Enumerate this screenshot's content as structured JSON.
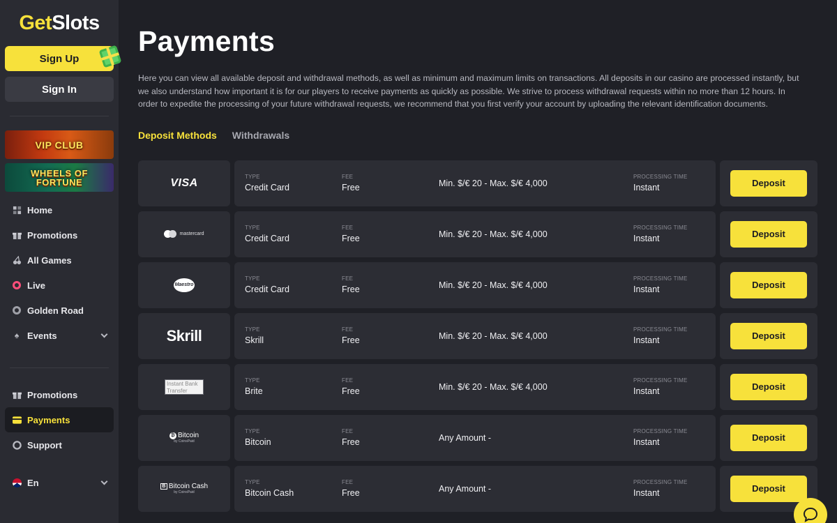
{
  "brand": {
    "get": "Get",
    "slots": "Slots"
  },
  "auth": {
    "signup": "Sign Up",
    "signin": "Sign In"
  },
  "banners": {
    "vip": "VIP CLUB",
    "wheel_line1": "WHEELS OF",
    "wheel_line2": "FORTUNE"
  },
  "nav": {
    "home": "Home",
    "promotions": "Promotions",
    "all_games": "All Games",
    "live": "Live",
    "golden_road": "Golden Road",
    "events": "Events"
  },
  "nav2": {
    "promotions": "Promotions",
    "payments": "Payments",
    "support": "Support"
  },
  "language": "En",
  "page": {
    "title": "Payments",
    "intro": "Here you can view all available deposit and withdrawal methods, as well as minimum and maximum limits on transactions. All deposits in our casino are processed instantly, but we also understand how important it is for our players to receive payments as quickly as possible. We strive to process withdrawal requests within no more than 12 hours. In order to expedite the processing of your future withdrawal requests, we recommend that you first verify your account by uploading the relevant identification documents."
  },
  "tabs": {
    "deposit": "Deposit Methods",
    "withdrawals": "Withdrawals"
  },
  "labels": {
    "type": "TYPE",
    "fee": "FEE",
    "processing": "PROCESSING TIME",
    "deposit_btn": "Deposit"
  },
  "methods": [
    {
      "logo": "VISA",
      "type": "Credit Card",
      "fee": "Free",
      "limits": "Min. $/€ 20 - Max. $/€ 4,000",
      "processing": "Instant"
    },
    {
      "logo": "mastercard",
      "type": "Credit Card",
      "fee": "Free",
      "limits": "Min. $/€ 20 - Max. $/€ 4,000",
      "processing": "Instant"
    },
    {
      "logo": "Maestro",
      "type": "Credit Card",
      "fee": "Free",
      "limits": "Min. $/€ 20 - Max. $/€ 4,000",
      "processing": "Instant"
    },
    {
      "logo": "Skrill",
      "type": "Skrill",
      "fee": "Free",
      "limits": "Min. $/€ 20 - Max. $/€ 4,000",
      "processing": "Instant"
    },
    {
      "logo": "Instant Bank Transfer",
      "type": "Brite",
      "fee": "Free",
      "limits": "Min. $/€ 20 - Max. $/€ 4,000",
      "processing": "Instant"
    },
    {
      "logo": "Bitcoin",
      "logo_sub": "by CoinsPaid",
      "type": "Bitcoin",
      "fee": "Free",
      "limits": "Any Amount -",
      "processing": "Instant"
    },
    {
      "logo": "Bitcoin Cash",
      "logo_sub": "by CoinsPaid",
      "type": "Bitcoin Cash",
      "fee": "Free",
      "limits": "Any Amount -",
      "processing": "Instant"
    }
  ],
  "icons": {
    "home": "home-icon",
    "promotions": "gift-icon",
    "all_games": "cherries-icon",
    "live": "live-icon",
    "golden_road": "road-icon",
    "events": "spade-icon",
    "payments": "card-icon",
    "support": "lifebuoy-icon",
    "chat": "chat-icon"
  },
  "colors": {
    "accent": "#f7e13b",
    "background": "#1f2026",
    "sidebar": "#2a2b32",
    "card": "#2c2d34",
    "live": "#ff4e7a"
  }
}
